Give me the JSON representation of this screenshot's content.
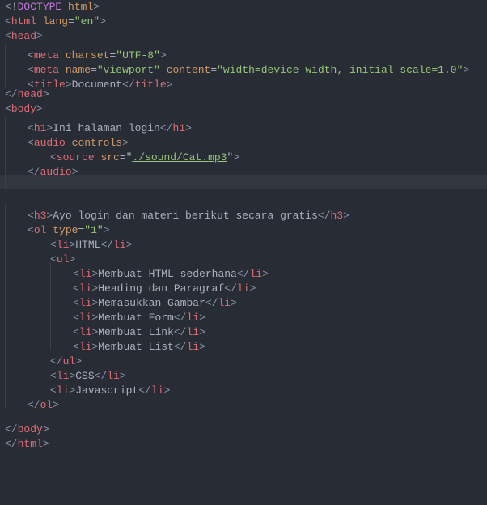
{
  "lines": [
    {
      "indent": 0,
      "tokens": [
        [
          "br",
          "<!"
        ],
        [
          "kw",
          "DOCTYPE"
        ],
        [
          "attr",
          " html"
        ],
        [
          "br",
          ">"
        ]
      ]
    },
    {
      "indent": 0,
      "tokens": [
        [
          "br",
          "<"
        ],
        [
          "tag",
          "html"
        ],
        [
          "p",
          " "
        ],
        [
          "attr",
          "lang"
        ],
        [
          "eq",
          "="
        ],
        [
          "str",
          "\"en\""
        ],
        [
          "br",
          ">"
        ]
      ]
    },
    {
      "indent": 0,
      "tokens": [
        [
          "br",
          "<"
        ],
        [
          "tag",
          "head"
        ],
        [
          "br",
          ">"
        ]
      ]
    },
    {
      "indent": 1,
      "tokens": [
        [
          "br",
          "<"
        ],
        [
          "tag",
          "meta"
        ],
        [
          "p",
          " "
        ],
        [
          "attr",
          "charset"
        ],
        [
          "eq",
          "="
        ],
        [
          "str",
          "\"UTF-8\""
        ],
        [
          "br",
          ">"
        ]
      ]
    },
    {
      "indent": 1,
      "tokens": [
        [
          "br",
          "<"
        ],
        [
          "tag",
          "meta"
        ],
        [
          "p",
          " "
        ],
        [
          "attr",
          "name"
        ],
        [
          "eq",
          "="
        ],
        [
          "str",
          "\"viewport\""
        ],
        [
          "p",
          " "
        ],
        [
          "attr",
          "content"
        ],
        [
          "eq",
          "="
        ],
        [
          "str",
          "\"width=device-width, initial-scale=1.0\""
        ],
        [
          "br",
          ">"
        ]
      ]
    },
    {
      "indent": 1,
      "tokens": [
        [
          "br",
          "<"
        ],
        [
          "tag",
          "title"
        ],
        [
          "br",
          ">"
        ],
        [
          "txt",
          "Document"
        ],
        [
          "br",
          "</"
        ],
        [
          "tag",
          "title"
        ],
        [
          "br",
          ">"
        ]
      ]
    },
    {
      "indent": 0,
      "tokens": [
        [
          "br",
          "</"
        ],
        [
          "tag",
          "head"
        ],
        [
          "br",
          ">"
        ]
      ]
    },
    {
      "indent": 0,
      "tokens": [
        [
          "br",
          "<"
        ],
        [
          "tag",
          "body"
        ],
        [
          "br",
          ">"
        ]
      ]
    },
    {
      "indent": 1,
      "tokens": [
        [
          "br",
          "<"
        ],
        [
          "tag",
          "h1"
        ],
        [
          "br",
          ">"
        ],
        [
          "txt",
          "Ini halaman login"
        ],
        [
          "br",
          "</"
        ],
        [
          "tag",
          "h1"
        ],
        [
          "br",
          ">"
        ]
      ]
    },
    {
      "indent": 1,
      "tokens": [
        [
          "br",
          "<"
        ],
        [
          "tag",
          "audio"
        ],
        [
          "p",
          " "
        ],
        [
          "attr",
          "controls"
        ],
        [
          "br",
          ">"
        ]
      ]
    },
    {
      "indent": 2,
      "tokens": [
        [
          "br",
          "<"
        ],
        [
          "tag",
          "source"
        ],
        [
          "p",
          " "
        ],
        [
          "attr",
          "src"
        ],
        [
          "eq",
          "="
        ],
        [
          "p",
          "\""
        ],
        [
          "str-u",
          "./sound/Cat.mp3"
        ],
        [
          "p",
          "\""
        ],
        [
          "br",
          ">"
        ]
      ]
    },
    {
      "indent": 1,
      "tokens": [
        [
          "br",
          "</"
        ],
        [
          "tag",
          "audio"
        ],
        [
          "br",
          ">"
        ]
      ]
    },
    {
      "indent": 1,
      "tokens": [],
      "cursor": true
    },
    {
      "indent": 0,
      "tokens": []
    },
    {
      "indent": 1,
      "tokens": [
        [
          "br",
          "<"
        ],
        [
          "tag",
          "h3"
        ],
        [
          "br",
          ">"
        ],
        [
          "txt",
          "Ayo login dan materi berikut secara gratis"
        ],
        [
          "br",
          "</"
        ],
        [
          "tag",
          "h3"
        ],
        [
          "br",
          ">"
        ]
      ]
    },
    {
      "indent": 1,
      "tokens": [
        [
          "br",
          "<"
        ],
        [
          "tag",
          "ol"
        ],
        [
          "p",
          " "
        ],
        [
          "attr",
          "type"
        ],
        [
          "eq",
          "="
        ],
        [
          "str",
          "\"1\""
        ],
        [
          "br",
          ">"
        ]
      ]
    },
    {
      "indent": 2,
      "tokens": [
        [
          "br",
          "<"
        ],
        [
          "tag",
          "li"
        ],
        [
          "br",
          ">"
        ],
        [
          "txt",
          "HTML"
        ],
        [
          "br",
          "</"
        ],
        [
          "tag",
          "li"
        ],
        [
          "br",
          ">"
        ]
      ]
    },
    {
      "indent": 2,
      "tokens": [
        [
          "br",
          "<"
        ],
        [
          "tag",
          "ul"
        ],
        [
          "br",
          ">"
        ]
      ]
    },
    {
      "indent": 3,
      "tokens": [
        [
          "br",
          "<"
        ],
        [
          "tag",
          "li"
        ],
        [
          "br",
          ">"
        ],
        [
          "txt",
          "Membuat HTML sederhana"
        ],
        [
          "br",
          "</"
        ],
        [
          "tag",
          "li"
        ],
        [
          "br",
          ">"
        ]
      ]
    },
    {
      "indent": 3,
      "tokens": [
        [
          "br",
          "<"
        ],
        [
          "tag",
          "li"
        ],
        [
          "br",
          ">"
        ],
        [
          "txt",
          "Heading dan Paragraf"
        ],
        [
          "br",
          "</"
        ],
        [
          "tag",
          "li"
        ],
        [
          "br",
          ">"
        ]
      ]
    },
    {
      "indent": 3,
      "tokens": [
        [
          "br",
          "<"
        ],
        [
          "tag",
          "li"
        ],
        [
          "br",
          ">"
        ],
        [
          "txt",
          "Memasukkan Gambar"
        ],
        [
          "br",
          "</"
        ],
        [
          "tag",
          "li"
        ],
        [
          "br",
          ">"
        ]
      ]
    },
    {
      "indent": 3,
      "tokens": [
        [
          "br",
          "<"
        ],
        [
          "tag",
          "li"
        ],
        [
          "br",
          ">"
        ],
        [
          "txt",
          "Membuat Form"
        ],
        [
          "br",
          "</"
        ],
        [
          "tag",
          "li"
        ],
        [
          "br",
          ">"
        ]
      ]
    },
    {
      "indent": 3,
      "tokens": [
        [
          "br",
          "<"
        ],
        [
          "tag",
          "li"
        ],
        [
          "br",
          ">"
        ],
        [
          "txt",
          "Membuat Link"
        ],
        [
          "br",
          "</"
        ],
        [
          "tag",
          "li"
        ],
        [
          "br",
          ">"
        ]
      ]
    },
    {
      "indent": 3,
      "tokens": [
        [
          "br",
          "<"
        ],
        [
          "tag",
          "li"
        ],
        [
          "br",
          ">"
        ],
        [
          "txt",
          "Membuat List"
        ],
        [
          "br",
          "</"
        ],
        [
          "tag",
          "li"
        ],
        [
          "br",
          ">"
        ]
      ]
    },
    {
      "indent": 2,
      "tokens": [
        [
          "br",
          "</"
        ],
        [
          "tag",
          "ul"
        ],
        [
          "br",
          ">"
        ]
      ]
    },
    {
      "indent": 2,
      "tokens": [
        [
          "br",
          "<"
        ],
        [
          "tag",
          "li"
        ],
        [
          "br",
          ">"
        ],
        [
          "txt",
          "CSS"
        ],
        [
          "br",
          "</"
        ],
        [
          "tag",
          "li"
        ],
        [
          "br",
          ">"
        ]
      ]
    },
    {
      "indent": 2,
      "tokens": [
        [
          "br",
          "<"
        ],
        [
          "tag",
          "li"
        ],
        [
          "br",
          ">"
        ],
        [
          "txt",
          "Javascript"
        ],
        [
          "br",
          "</"
        ],
        [
          "tag",
          "li"
        ],
        [
          "br",
          ">"
        ]
      ]
    },
    {
      "indent": 1,
      "tokens": [
        [
          "br",
          "</"
        ],
        [
          "tag",
          "ol"
        ],
        [
          "br",
          ">"
        ]
      ]
    },
    {
      "indent": 0,
      "tokens": []
    },
    {
      "indent": 0,
      "tokens": [
        [
          "br",
          "</"
        ],
        [
          "tag",
          "body"
        ],
        [
          "br",
          ">"
        ]
      ]
    },
    {
      "indent": 0,
      "tokens": [
        [
          "br",
          "</"
        ],
        [
          "tag",
          "html"
        ],
        [
          "br",
          ">"
        ]
      ]
    }
  ]
}
